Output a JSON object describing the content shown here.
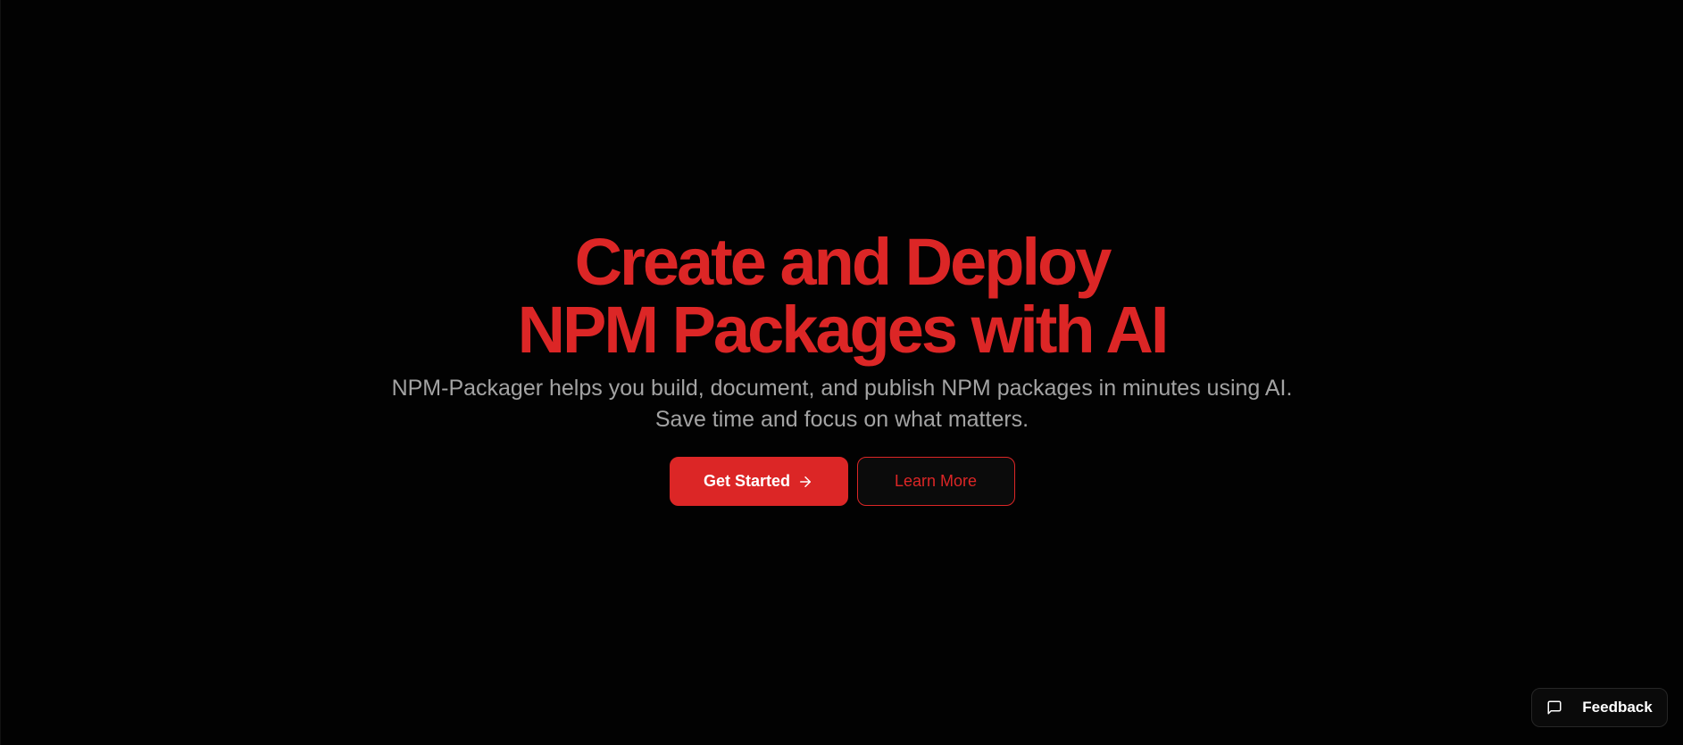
{
  "hero": {
    "title_line1": "Create and Deploy",
    "title_line2": "NPM Packages with AI",
    "subtitle_line1": "NPM-Packager helps you build, document, and publish NPM packages in minutes using AI.",
    "subtitle_line2": "Save time and focus on what matters."
  },
  "actions": {
    "primary_label": "Get Started",
    "primary_icon": "arrow-right-icon",
    "secondary_label": "Learn More"
  },
  "feedback": {
    "label": "Feedback",
    "icon": "message-square-icon"
  },
  "colors": {
    "background": "#020202",
    "accent": "#dc2626",
    "subtitle_text": "#a3a3a3",
    "button_text": "#ffffff"
  }
}
